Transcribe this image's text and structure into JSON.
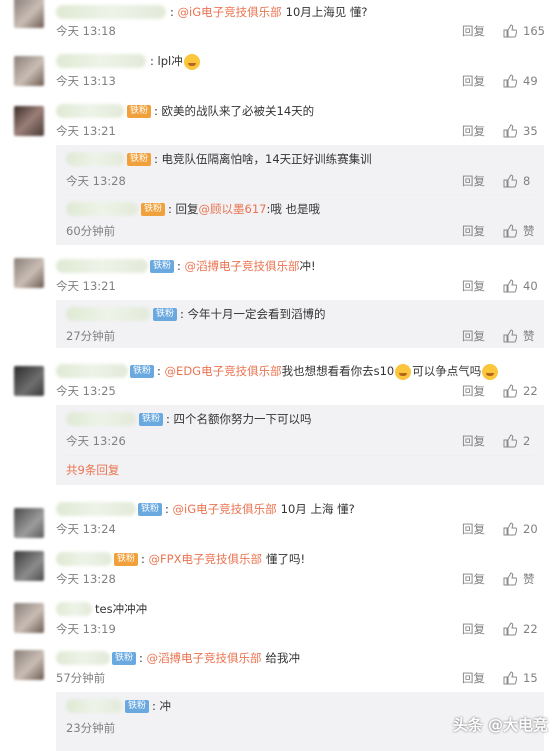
{
  "reply_label": "回复",
  "like_label_empty": "赞",
  "comments": [
    {
      "mention": "@iG电子竞技俱乐部",
      "text": "10月上海见 懂?",
      "time": "今天 13:18",
      "likes": "165"
    },
    {
      "text": "lpl冲",
      "time": "今天 13:13",
      "likes": "49"
    },
    {
      "badge": "铁粉",
      "text": "欧美的战队来了必被关14天的",
      "time": "今天 13:21",
      "likes": "35",
      "replies": [
        {
          "badge": "铁粉",
          "text": "电竞队伍隔离怕啥，14天正好训练赛集训",
          "time": "今天 13:28",
          "likes": "8"
        },
        {
          "badge": "铁粉",
          "prefix": "回复",
          "mention": "@顾以墨617",
          "text": ":哦 也是哦",
          "time": "60分钟前",
          "likes": "赞"
        }
      ]
    },
    {
      "badge": "铁粉",
      "mention": "@滔搏电子竞技俱乐部",
      "text": "冲!",
      "time": "今天 13:21",
      "likes": "40",
      "replies": [
        {
          "badge": "铁粉",
          "text": "今年十月一定会看到滔博的",
          "time": "27分钟前",
          "likes": "赞"
        }
      ]
    },
    {
      "badge": "铁粉",
      "mention": "@EDG电子竞技俱乐部",
      "text": "我也想想看看你去s10",
      "text2": "可以争点气吗",
      "time": "今天 13:25",
      "likes": "22",
      "replies": [
        {
          "badge": "铁粉",
          "text": "四个名额你努力一下可以吗",
          "time": "今天 13:26",
          "likes": "2"
        }
      ],
      "more": "共9条回复"
    },
    {
      "badge": "铁粉",
      "mention": "@iG电子竞技俱乐部",
      "text": "10月 上海 懂?",
      "time": "今天 13:24",
      "likes": "20"
    },
    {
      "badge": "铁粉",
      "mention": "@FPX电子竞技俱乐部",
      "text": "懂了吗!",
      "time": "今天 13:28",
      "likes": "赞"
    },
    {
      "text": "tes冲冲冲",
      "time": "今天 13:19",
      "likes": "22"
    },
    {
      "badge": "铁粉",
      "mention": "@滔搏电子竞技俱乐部",
      "text": "给我冲",
      "time": "57分钟前",
      "likes": "15",
      "replies": [
        {
          "badge": "铁粉",
          "text": "冲",
          "time": "23分钟前"
        }
      ]
    }
  ],
  "watermark": "头条 @大电竞"
}
